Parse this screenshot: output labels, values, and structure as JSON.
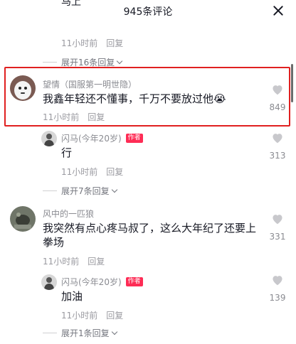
{
  "header": {
    "title": "945条评论"
  },
  "top_cut": {
    "text": "马上"
  },
  "prev_meta": {
    "time": "11小时前",
    "reply": "回复"
  },
  "prev_expand": "展开16条回复",
  "comments": [
    {
      "name": "望情（国服第一明世隐）",
      "text": "我鑫年轻还不懂事，千万不要放过他😭",
      "time": "11小时前",
      "reply": "回复",
      "likes": "849"
    },
    {
      "name": "闪马(今年20岁)",
      "badge": "作者",
      "text": "行",
      "time": "11小时前",
      "reply": "回复",
      "likes": "313",
      "expand": "展开7条回复"
    },
    {
      "name": "风中的一匹狼",
      "text_line1": "我突然有点心疼马叔了，这么大年纪了还要上",
      "text_line2": "拳场",
      "time": "11小时前",
      "reply": "回复",
      "likes": "331"
    },
    {
      "name": "闪马(今年20岁)",
      "badge": "作者",
      "text": "加油",
      "time": "11小时前",
      "reply": "回复",
      "likes": "139",
      "expand": "展开1条回复"
    }
  ],
  "colors": {
    "highlight": "#e02020",
    "badge": "#fe2c55",
    "meta": "#9a9aa0"
  }
}
